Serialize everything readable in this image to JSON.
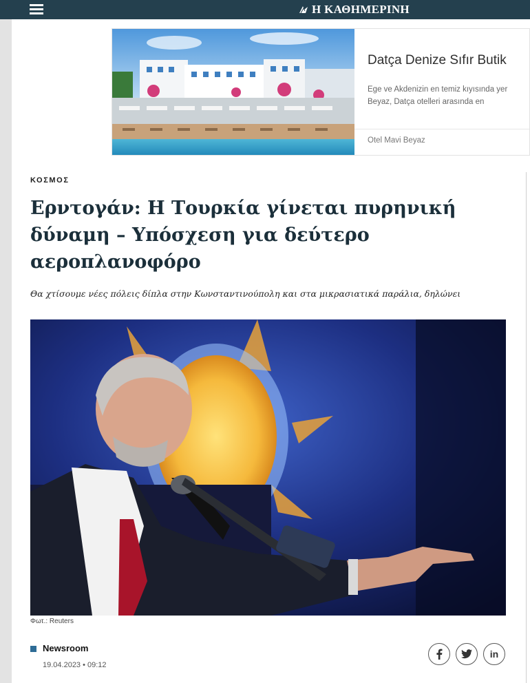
{
  "header": {
    "brand": "Η ΚΑΘΗΜΕΡΙΝΗ",
    "menu_icon": "hamburger-menu-icon",
    "background": "#24404e"
  },
  "ad": {
    "title": "Datça Denize Sıfır Butik",
    "description_line1": "Ege ve Akdenizin en temiz kıyısında yer",
    "description_line2": "Beyaz, Datça otelleri arasında en",
    "source": "Otel Mavi Beyaz"
  },
  "article": {
    "section": "ΚΟΣΜΟΣ",
    "headline_line1": "Ερντογάν: Η Τουρκία γίνεται πυρηνική",
    "headline_line2": "δύναμη – Υπόσχεση για δεύτερο",
    "headline_line3": "αεροπλανοφόρο",
    "subheadline": "Θα χτίσουμε νέες πόλεις δίπλα στην Κωνσταντινούπολη και στα μικρασιατικά παράλια, δηλώνει",
    "photo_caption": "Φωτ.: Reuters",
    "author": "Newsroom",
    "date": "19.04.2023 • 09:12",
    "accent_color": "#2e6c96"
  },
  "share": {
    "facebook_icon": "facebook-icon",
    "twitter_icon": "twitter-icon",
    "linkedin_label": "in"
  }
}
